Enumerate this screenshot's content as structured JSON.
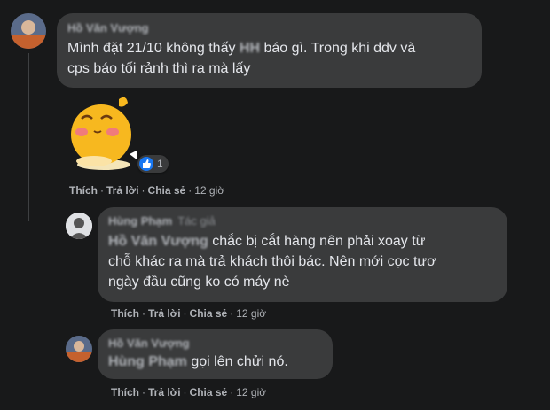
{
  "comments": [
    {
      "author": "Hồ Văn Vượng",
      "text": "Mình đặt 21/10 không thấy HH báo gì. Trong khi ddv và cps báo tối rảnh thì ra mà lấy",
      "text_line1_a": "Mình đặt 21/10 không thấy ",
      "text_blur": "HH",
      "text_line1_b": " báo gì. Trong khi ddv và",
      "text_line2": "cps báo tối rảnh thì ra mà lấy",
      "reaction_count": "1",
      "sticker": "yellow-chick-sticker",
      "actions": {
        "like": "Thích",
        "reply": "Trả lời",
        "share": "Chia sẻ",
        "time": "12 giờ"
      }
    },
    {
      "author": "Hùng Phạm",
      "author_tag": "Tác giả",
      "mention": "Hồ Văn Vượng",
      "text_line1": " chắc bị cắt hàng nên phải xoay từ",
      "text_line2": "chỗ khác ra mà trả khách thôi bác. Nên mới cọc tươ",
      "text_line3": "ngày đầu cũng ko có máy nè",
      "actions": {
        "like": "Thích",
        "reply": "Trả lời",
        "share": "Chia sẻ",
        "time": "12 giờ"
      }
    },
    {
      "author": "Hồ Văn Vượng",
      "mention": "Hùng Phạm",
      "text_line1": " gọi lên chửi nó.",
      "actions": {
        "like": "Thích",
        "reply": "Trả lời",
        "share": "Chia sẻ",
        "time": "12 giờ"
      }
    }
  ],
  "colors": {
    "background": "#18191a",
    "bubble": "#3a3b3c",
    "like_blue": "#1877f2"
  }
}
